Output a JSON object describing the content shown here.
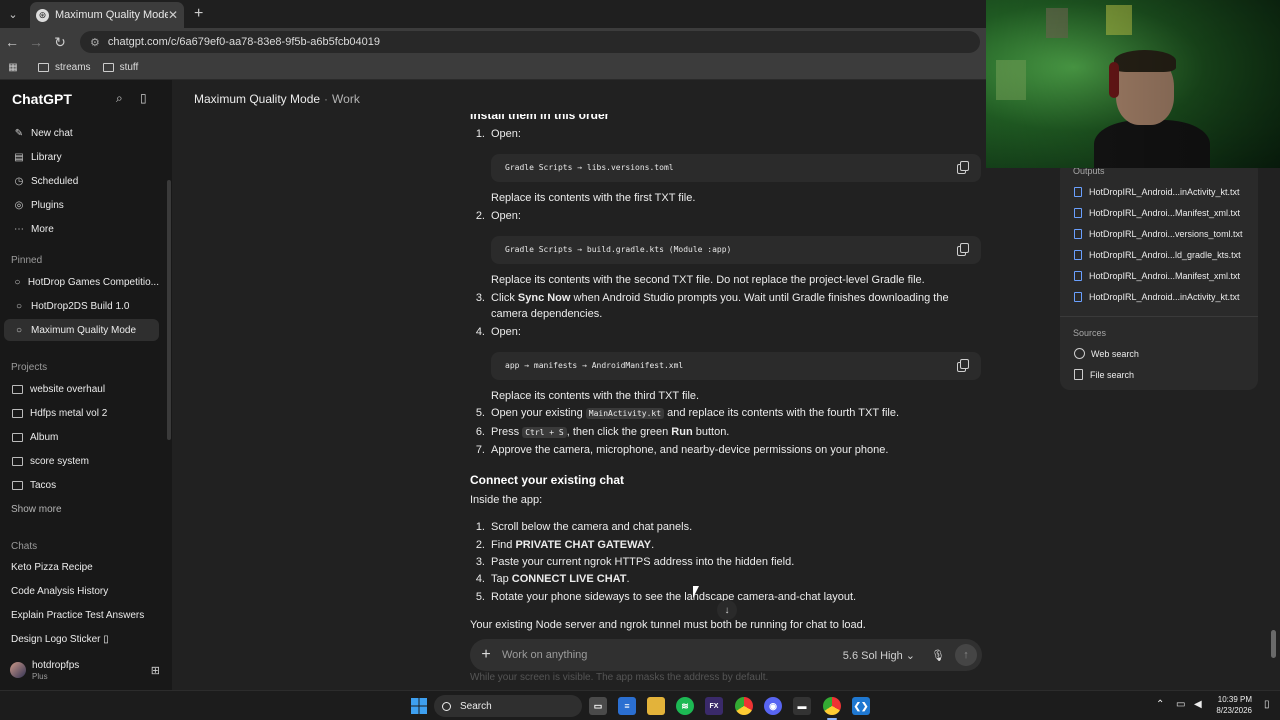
{
  "browser": {
    "tab_title": "Maximum Quality Mode",
    "url": "chatgpt.com/c/6a679ef0-aa78-83e8-9f5b-a6b5fcb04019",
    "bookmarks": [
      "streams",
      "stuff"
    ]
  },
  "sidebar": {
    "brand": "ChatGPT",
    "top_items": [
      {
        "label": "New chat",
        "icon": "edit-icon"
      },
      {
        "label": "Library",
        "icon": "library-icon"
      },
      {
        "label": "Scheduled",
        "icon": "clock-icon"
      },
      {
        "label": "Plugins",
        "icon": "plugin-icon"
      },
      {
        "label": "More",
        "icon": "more-icon"
      }
    ],
    "pinned_label": "Pinned",
    "pinned": [
      "HotDrop Games Competitio...",
      "HotDrop2DS Build 1.0",
      "Maximum Quality Mode"
    ],
    "projects_label": "Projects",
    "projects": [
      "website overhaul",
      "Hdfps metal vol 2",
      "Album",
      "score system",
      "Tacos"
    ],
    "show_more": "Show more",
    "chats_label": "Chats",
    "chats": [
      "Keto Pizza Recipe",
      "Code Analysis History",
      "Explain Practice Test Answers",
      "Design Logo Sticker ▯"
    ],
    "user_name": "hotdropfps",
    "user_plan": "Plus"
  },
  "header": {
    "title": "Maximum Quality Mode",
    "project": "Work"
  },
  "content": {
    "cut_heading": "Install them in this order",
    "steps1": [
      {
        "n": "1.",
        "open": "Open:",
        "code": "Gradle Scripts → libs.versions.toml",
        "after": "Replace its contents with the first TXT file."
      },
      {
        "n": "2.",
        "open": "Open:",
        "code": "Gradle Scripts → build.gradle.kts (Module :app)",
        "after": "Replace its contents with the second TXT file. Do not replace the project-level Gradle file."
      }
    ],
    "step3": {
      "n": "3.",
      "pre": "Click ",
      "bold": "Sync Now",
      "post": " when Android Studio prompts you. Wait until Gradle finishes downloading the camera dependencies."
    },
    "step4": {
      "n": "4.",
      "open": "Open:",
      "code": "app → manifests → AndroidManifest.xml",
      "after": "Replace its contents with the third TXT file."
    },
    "step5": {
      "n": "5.",
      "pre": "Open your existing ",
      "code": "MainActivity.kt",
      "post": " and replace its contents with the fourth TXT file."
    },
    "step6": {
      "n": "6.",
      "pre": "Press ",
      "code": "Ctrl + S",
      "mid": ", then click the green ",
      "bold": "Run",
      "post": " button."
    },
    "step7": {
      "n": "7.",
      "text": "Approve the camera, microphone, and nearby-device permissions on your phone."
    },
    "heading2": "Connect your existing chat",
    "intro2": "Inside the app:",
    "steps2": [
      {
        "n": "1.",
        "pre": "Scroll below the camera and chat panels.",
        "bold": "",
        "post": ""
      },
      {
        "n": "2.",
        "pre": "Find ",
        "bold": "PRIVATE CHAT GATEWAY",
        "post": "."
      },
      {
        "n": "3.",
        "pre": "Paste your current ngrok HTTPS address into the hidden field.",
        "bold": "",
        "post": ""
      },
      {
        "n": "4.",
        "pre": "Tap ",
        "bold": "CONNECT LIVE CHAT",
        "post": "."
      },
      {
        "n": "5.",
        "pre": "Rotate your phone sideways to see the landscape camera-and-chat layout.",
        "bold": "",
        "post": ""
      }
    ],
    "closing": "Your existing Node server and ngrok tunnel must both be running for chat to load.",
    "under_text": "While your screen is visible. The app masks the address by default."
  },
  "composer": {
    "placeholder": "Work on anything",
    "model": "5.6 Sol High"
  },
  "panel": {
    "outputs_label": "Outputs",
    "outputs": [
      "HotDropIRL_Android...inActivity_kt.txt",
      "HotDropIRL_Androi...Manifest_xml.txt",
      "HotDropIRL_Androi...versions_toml.txt",
      "HotDropIRL_Androi...ld_gradle_kts.txt",
      "HotDropIRL_Androi...Manifest_xml.txt",
      "HotDropIRL_Android...inActivity_kt.txt"
    ],
    "sources_label": "Sources",
    "sources": [
      "Web search",
      "File search"
    ]
  },
  "taskbar": {
    "search": "Search",
    "time": "10:39 PM",
    "date": "8/23/2026"
  }
}
